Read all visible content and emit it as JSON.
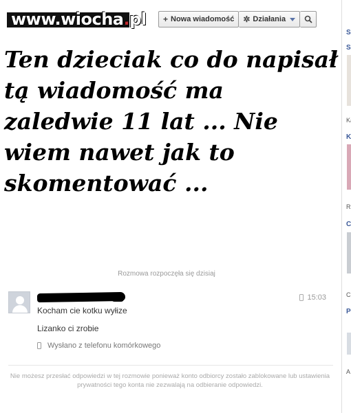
{
  "watermark": {
    "text_main": "www.wiocha",
    "text_dot": ".",
    "text_tld": "pl"
  },
  "toolbar": {
    "new_message_icon": "plus-icon",
    "new_message_label": "Nowa wiadomość",
    "actions_icon": "gear-icon",
    "actions_label": "Działania",
    "search_icon": "magnifier-icon"
  },
  "caption": "Ten dzieciak co do napisał tą wiadomość ma zaledwie 11 lat ... Nie wiem nawet jak to skomentować ...",
  "conversation": {
    "started_label": "Rozmowa rozpoczęła się dzisiaj",
    "message": {
      "time": "15:03",
      "lines": [
        "Kocham cie kotku wyłize",
        "Lizanko ci zrobie"
      ],
      "sent_via": "Wysłano z telefonu komórkowego"
    },
    "notice": "Nie możesz przesłać odpowiedzi w tej rozmowie ponieważ konto odbiorcy zostało zablokowane lub ustawienia prywatności tego konta nie zezwalają na odbieranie odpowiedzi."
  },
  "right_sidebar": {
    "items": [
      "S",
      "S",
      "K",
      "C",
      "P"
    ],
    "small": [
      "Ka",
      "Ra",
      "C",
      "A"
    ]
  },
  "colors": {
    "link_blue": "#3b5998",
    "muted_text": "#999999"
  }
}
